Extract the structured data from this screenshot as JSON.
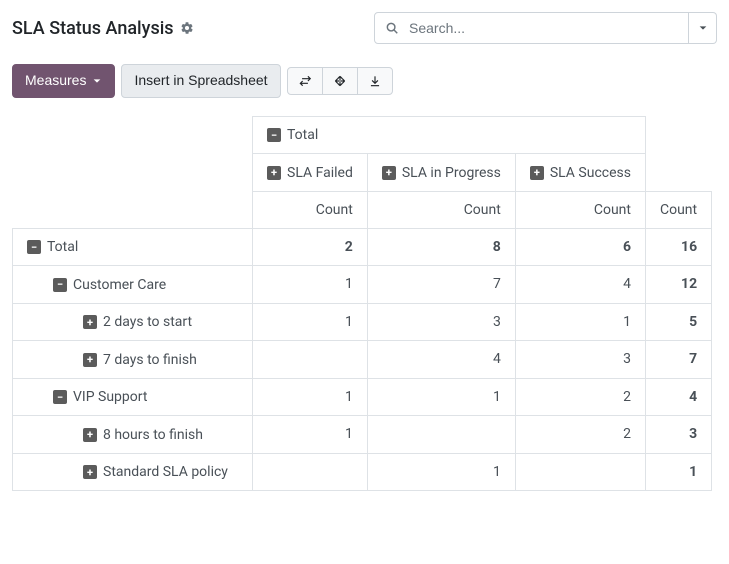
{
  "header": {
    "title": "SLA Status Analysis",
    "search_placeholder": "Search..."
  },
  "toolbar": {
    "measures_label": "Measures",
    "insert_label": "Insert in Spreadsheet"
  },
  "pivot": {
    "column_group_label": "Total",
    "columns": [
      "SLA Failed",
      "SLA in Progress",
      "SLA Success"
    ],
    "measure_label": "Count",
    "rows": [
      {
        "label": "Total",
        "level": 0,
        "expanded": true,
        "values": [
          "2",
          "8",
          "6"
        ],
        "total": "16",
        "is_total": true
      },
      {
        "label": "Customer Care",
        "level": 1,
        "expanded": true,
        "values": [
          "1",
          "7",
          "4"
        ],
        "total": "12",
        "is_total": false
      },
      {
        "label": "2 days to start",
        "level": 2,
        "expanded": false,
        "values": [
          "1",
          "3",
          "1"
        ],
        "total": "5",
        "is_total": false
      },
      {
        "label": "7 days to finish",
        "level": 2,
        "expanded": false,
        "values": [
          "",
          "4",
          "3"
        ],
        "total": "7",
        "is_total": false
      },
      {
        "label": "VIP Support",
        "level": 1,
        "expanded": true,
        "values": [
          "1",
          "1",
          "2"
        ],
        "total": "4",
        "is_total": false
      },
      {
        "label": "8 hours to finish",
        "level": 2,
        "expanded": false,
        "values": [
          "1",
          "",
          "2"
        ],
        "total": "3",
        "is_total": false
      },
      {
        "label": "Standard SLA policy",
        "level": 2,
        "expanded": false,
        "values": [
          "",
          "1",
          ""
        ],
        "total": "1",
        "is_total": false
      }
    ]
  }
}
